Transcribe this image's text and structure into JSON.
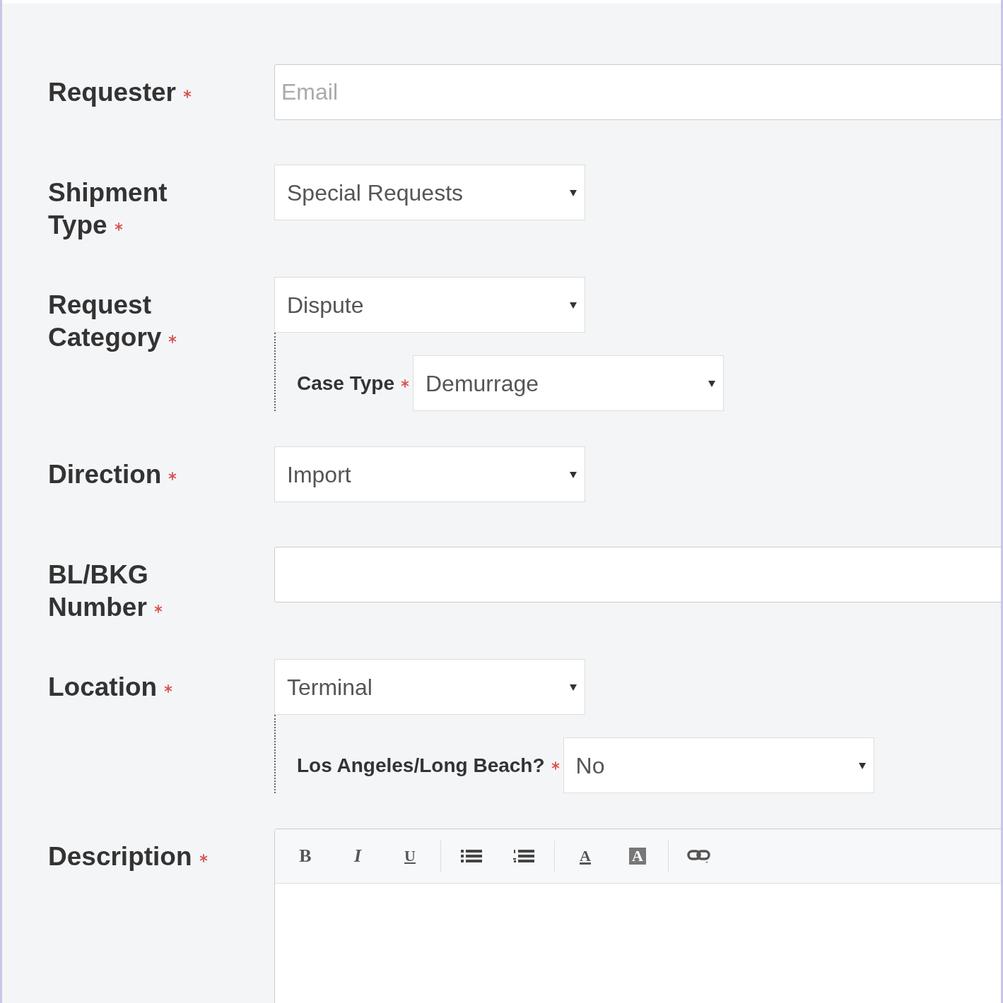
{
  "fields": [
    {
      "label": "Requester",
      "required": true,
      "kind": "text",
      "placeholder": "Email"
    },
    {
      "label": "Shipment Type",
      "required": true,
      "kind": "select",
      "value": "Special Requests"
    },
    {
      "label": "Request Category",
      "required": true,
      "kind": "select",
      "value": "Dispute",
      "sub": {
        "label": "Case Type",
        "required": true,
        "value": "Demurrage"
      }
    },
    {
      "label": "Direction",
      "required": true,
      "kind": "select",
      "value": "Import"
    },
    {
      "label": "BL/BKG Number",
      "required": true,
      "kind": "text"
    },
    {
      "label": "Location",
      "required": true,
      "kind": "select",
      "value": "Terminal",
      "sub": {
        "label": "Los Angeles/Long Beach?",
        "required": true,
        "value": "No"
      }
    },
    {
      "label": "Description",
      "required": true,
      "kind": "editor",
      "toolbar": [
        [
          {
            "kind": "bold",
            "text": "B"
          },
          {
            "kind": "italic",
            "text": "I"
          },
          {
            "kind": "underline",
            "text": "U"
          }
        ],
        [
          {
            "kind": "bullet-list"
          },
          {
            "kind": "numbered-list"
          }
        ],
        [
          {
            "kind": "font-color",
            "text": "A"
          },
          {
            "kind": "highlight",
            "text": "A"
          }
        ],
        [
          {
            "kind": "link"
          }
        ]
      ]
    }
  ]
}
